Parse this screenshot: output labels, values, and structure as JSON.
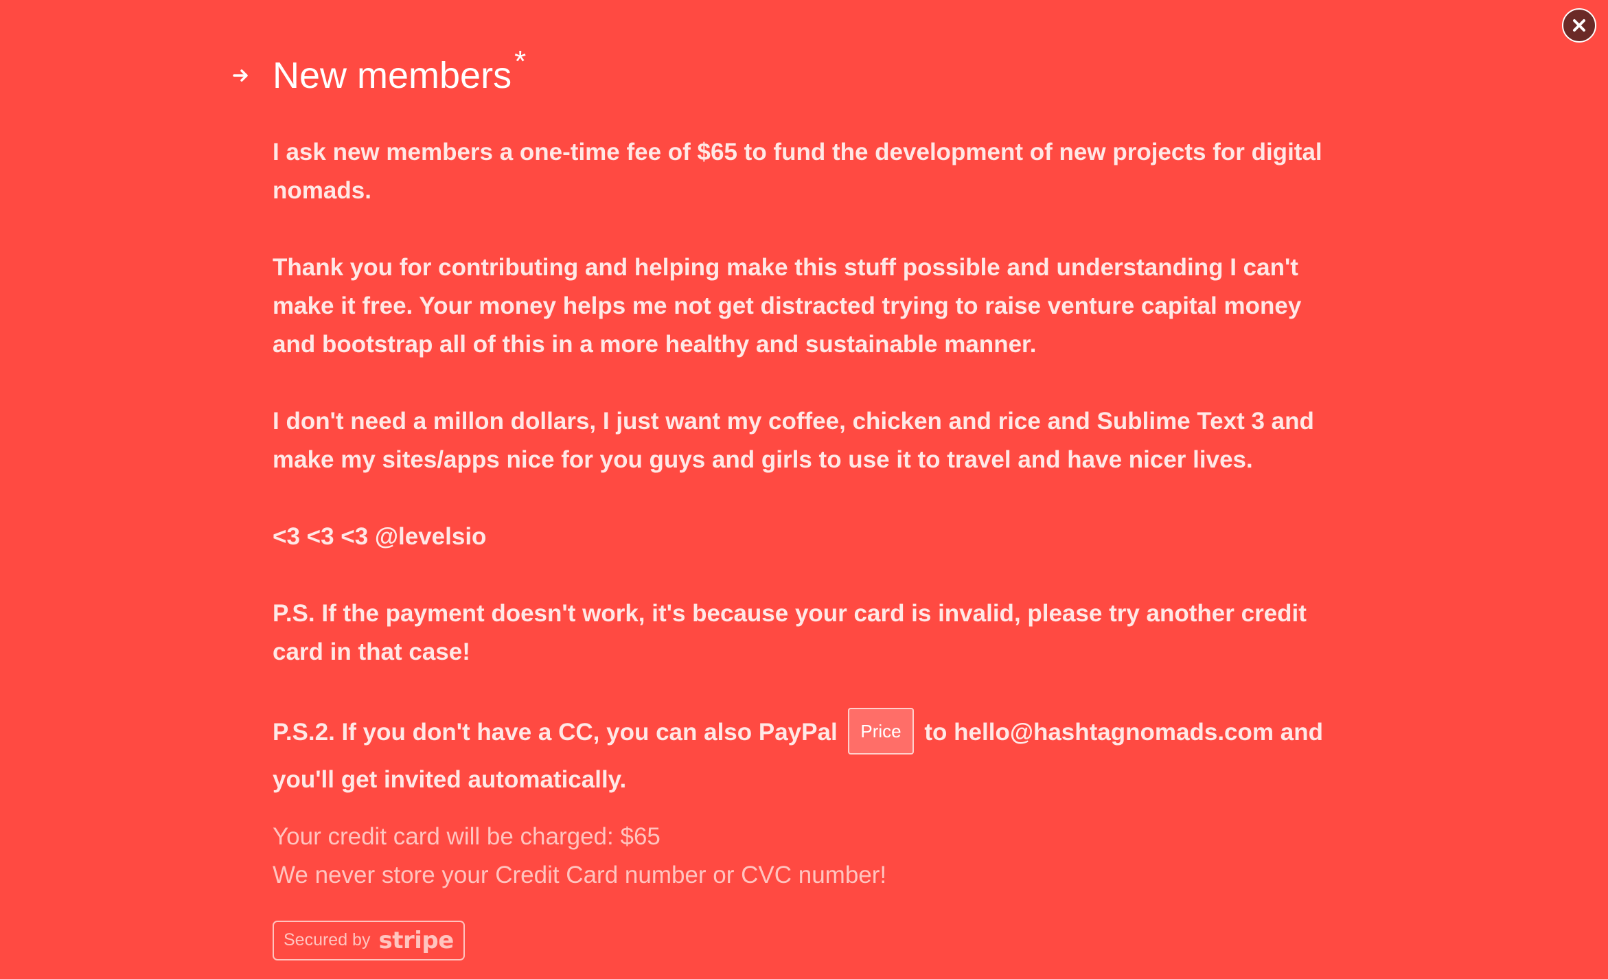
{
  "close": {
    "icon": "close-icon",
    "background": "#6b2a27"
  },
  "section": {
    "arrow_icon": "arrow-right-icon",
    "title": "New members",
    "title_suffix": "*"
  },
  "paragraphs": [
    "I ask new members a one-time fee of $65 to fund the development of new projects for digital nomads.",
    "Thank you for contributing and helping make this stuff possible and understanding I can't make it free. Your money helps me not get distracted trying to raise venture capital money and bootstrap all of this in a more healthy and sustainable manner.",
    "I don't need a millon dollars, I just want my coffee, chicken and rice and Sublime Text 3 and make my sites/apps nice for you guys and girls to use it to travel and have nicer lives.",
    "<3 <3 <3 @levelsio",
    "P.S. If the payment doesn't work, it's because your card is invalid, please try another credit card in that case!"
  ],
  "paypal_note": {
    "before": "P.S.2. If you don't have a CC, you can also PayPal",
    "price_button": "Price",
    "after": "to hello@hashtagnomads.com and you'll get invited automatically."
  },
  "charge_note": "Your credit card will be charged: $65",
  "storage_note": "We never store your Credit Card number or CVC number!",
  "stripe_badge": {
    "prefix": "Secured by",
    "brand": "stripe"
  },
  "colors": {
    "background": "#ff4a42",
    "text": "#ffffff",
    "muted_text": "#ffc4bf"
  }
}
